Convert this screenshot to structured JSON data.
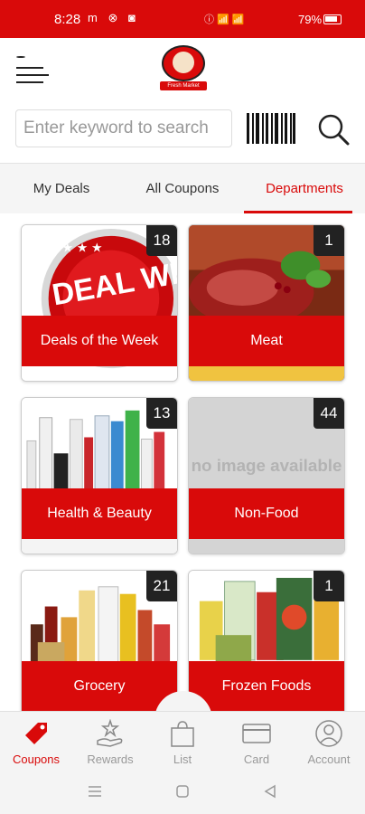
{
  "status_bar": {
    "time": "8:28",
    "left_icons": "m ⊗ ◙",
    "right_icons": "ⓘ  📶  📶",
    "battery": "79%"
  },
  "header": {
    "logo_tag": "Fresh Market"
  },
  "search": {
    "placeholder": "Enter keyword to search"
  },
  "tabs": [
    {
      "label": "My Deals"
    },
    {
      "label": "All Coupons"
    },
    {
      "label": "Departments",
      "active": true
    }
  ],
  "departments": [
    {
      "label": "Deals of the Week",
      "count": "18",
      "image_text": "DEAL WEEK"
    },
    {
      "label": "Meat",
      "count": "1"
    },
    {
      "label": "Health & Beauty",
      "count": "13"
    },
    {
      "label": "Non-Food",
      "count": "44",
      "image_text": "no image available"
    },
    {
      "label": "Grocery",
      "count": "21"
    },
    {
      "label": "Frozen Foods",
      "count": "1"
    }
  ],
  "bottom_nav": [
    {
      "label": "Coupons",
      "icon": "tag-icon",
      "active": true
    },
    {
      "label": "Rewards",
      "icon": "reward-hand-icon"
    },
    {
      "label": "List",
      "icon": "shopping-bag-icon"
    },
    {
      "label": "Card",
      "icon": "card-icon"
    },
    {
      "label": "Account",
      "icon": "account-icon"
    }
  ],
  "colors": {
    "brand_red": "#d90a0a",
    "badge": "#222222"
  }
}
